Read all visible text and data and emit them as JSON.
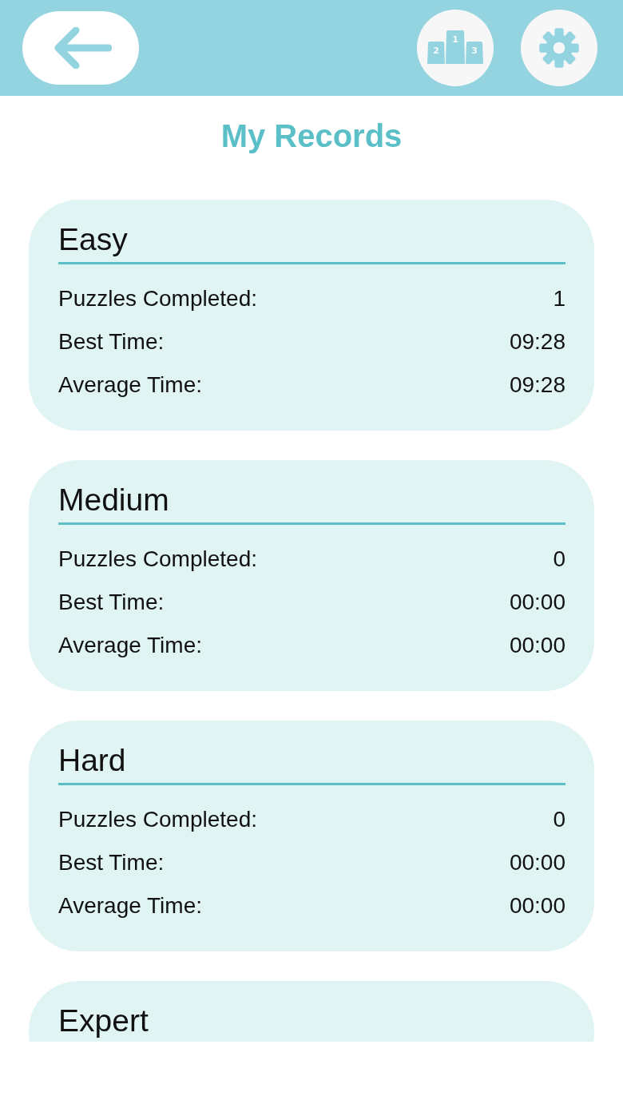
{
  "header": {
    "leaderboard_button": {
      "ranks": [
        "2",
        "1",
        "3"
      ]
    }
  },
  "title": "My Records",
  "records": [
    {
      "level": "Easy",
      "stats": [
        {
          "label": "Puzzles Completed:",
          "value": "1"
        },
        {
          "label": "Best Time:",
          "value": "09:28"
        },
        {
          "label": "Average Time:",
          "value": "09:28"
        }
      ]
    },
    {
      "level": "Medium",
      "stats": [
        {
          "label": "Puzzles Completed:",
          "value": "0"
        },
        {
          "label": "Best Time:",
          "value": "00:00"
        },
        {
          "label": "Average Time:",
          "value": "00:00"
        }
      ]
    },
    {
      "level": "Hard",
      "stats": [
        {
          "label": "Puzzles Completed:",
          "value": "0"
        },
        {
          "label": "Best Time:",
          "value": "00:00"
        },
        {
          "label": "Average Time:",
          "value": "00:00"
        }
      ]
    },
    {
      "level": "Expert"
    }
  ]
}
